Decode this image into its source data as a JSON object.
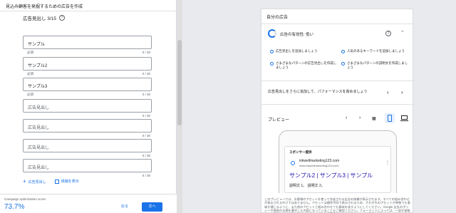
{
  "left": {
    "header_title": "見込み顧客を発掘するための広告を作成",
    "section_title": "広告見出し 3/15",
    "help": "?",
    "fields": [
      {
        "value": "サンプル",
        "placeholder": "",
        "required": "必須",
        "count": "0 / 30"
      },
      {
        "value": "サンプル2",
        "placeholder": "",
        "required": "必須",
        "count": "0 / 30"
      },
      {
        "value": "サンプル3",
        "placeholder": "",
        "required": "必須",
        "count": "0 / 30"
      },
      {
        "value": "",
        "placeholder": "広告見出し",
        "required": "",
        "count": "0 / 30"
      },
      {
        "value": "",
        "placeholder": "広告見出し",
        "required": "",
        "count": "0 / 30"
      },
      {
        "value": "",
        "placeholder": "広告見出し",
        "required": "",
        "count": "0 / 30"
      },
      {
        "value": "",
        "placeholder": "広告見出し",
        "required": "",
        "count": "0 / 30"
      }
    ],
    "add_headline": "広告見出し",
    "show_candidates": "候補を表示",
    "footer": {
      "opt_label": "Campaign optimization score",
      "opt_value": "73.7%",
      "back": "戻る",
      "next": "次へ"
    }
  },
  "right": {
    "title": "自分の広告",
    "effectiveness": "広告の有効性: 低い",
    "suggestions": [
      "広告見出しを追加しましょう",
      "人気のあるキーワードを追加しましょう",
      "さまざまなパターンの広告見出しを作成しましょう",
      "さまざまなパターンの説明文を作成しましょう"
    ],
    "hint": "広告見出しをさらに追加して、パフォーマンスを高めましょう",
    "preview_label": "プレビュー",
    "ad": {
      "sponsor": "スポンサー提供",
      "domain": "inkwellmarketing123.com",
      "url": "www.inkwellmarketing123.com/",
      "headline": "サンプル2 | サンプル3 | サンプル",
      "description": "説明文 1。 説明文 2。"
    },
    "disclaimer": "このプレビューでは、お客様のアセットを使って作成される広告の候補が表示されます。すべての組み合わせが表示されるわけではありません。アセットは順序不同で表示されるため、それぞれのアセットが単独でも意味が通じるように、また他のアセットと組み合わせても意味を成すようにしてください。Google 広告のポリシーや現地の法規を遵守した内容になっていることもご確認ください。フォーマットによっては、一部が省略される場合もあります。特定のテキストが広告に表示されるようにすることは可能です。"
  },
  "colors": {
    "accent": "#1a73e8",
    "ad_headline": "#1a0dab"
  }
}
